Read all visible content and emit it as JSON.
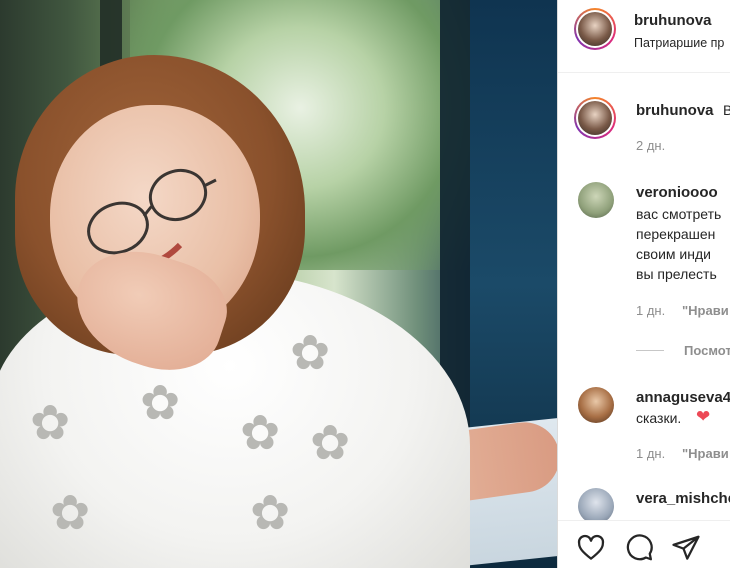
{
  "header": {
    "username": "bruhunova",
    "location": "Патриаршие пр"
  },
  "caption": {
    "username": "bruhunova",
    "text_start": "В",
    "time": "2 дн."
  },
  "comments": [
    {
      "username": "veronioooo",
      "lines": [
        "вас смотреть",
        "перекрашен",
        "своим инди",
        "вы прелесть"
      ],
      "time": "1 дн.",
      "reply_label": "\"Нрави"
    },
    {
      "username": "annaguseva4",
      "lines": [
        "сказки."
      ],
      "emoji": "❤",
      "time": "1 дн.",
      "reply_label": "\"Нрави"
    },
    {
      "username": "vera_mishche"
    }
  ],
  "view_replies": "Посмот",
  "actions": {
    "like": "heart-icon",
    "comment": "comment-icon",
    "share": "share-icon"
  },
  "colors": {
    "accent_heart": "#ed4956",
    "text": "#262626",
    "muted": "#8e8e8e"
  }
}
